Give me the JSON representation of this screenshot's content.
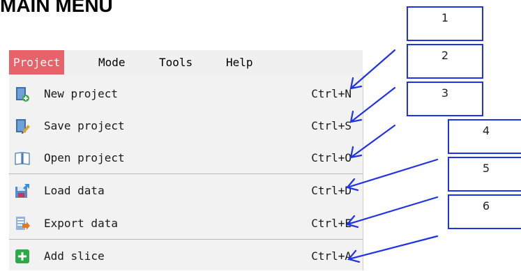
{
  "heading": "MAIN MENU",
  "menubar": {
    "items": [
      "Project",
      "Mode",
      "Tools",
      "Help"
    ],
    "active_color": "#e8626a"
  },
  "menu": {
    "items": [
      {
        "label": "New project",
        "shortcut": "Ctrl+N",
        "icon": "new-project-icon"
      },
      {
        "label": "Save project",
        "shortcut": "Ctrl+S",
        "icon": "save-project-icon"
      },
      {
        "label": "Open project",
        "shortcut": "Ctrl+O",
        "icon": "open-book-icon"
      },
      {
        "label": "Load data",
        "shortcut": "Ctrl+D",
        "icon": "load-data-icon"
      },
      {
        "label": "Export data",
        "shortcut": "Ctrl+E",
        "icon": "export-data-icon"
      },
      {
        "label": "Add slice",
        "shortcut": "Ctrl+A",
        "icon": "add-slice-icon"
      }
    ]
  },
  "callouts": [
    "1",
    "2",
    "3",
    "4",
    "5",
    "6"
  ],
  "arrow_color": "#1e32e8"
}
